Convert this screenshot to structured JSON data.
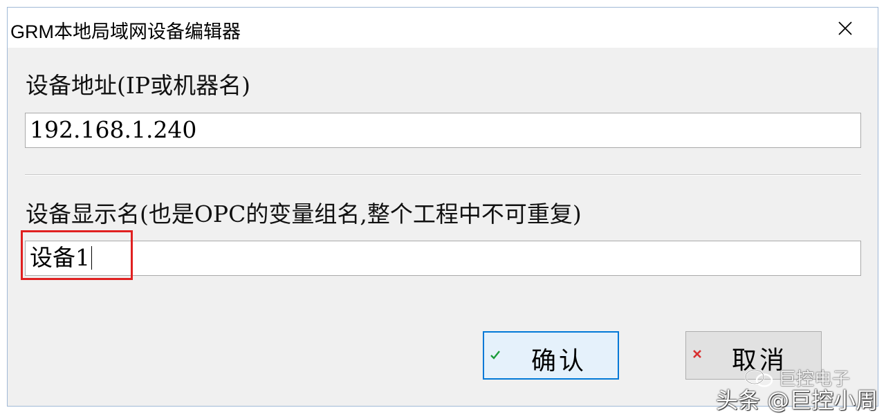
{
  "window": {
    "title": "GRM本地局域网设备编辑器",
    "close_icon": "close-icon"
  },
  "form": {
    "address_label": "设备地址(IP或机器名)",
    "address_value": "192.168.1.240",
    "display_name_label": "设备显示名(也是OPC的变量组名,整个工程中不可重复)",
    "display_name_value": "设备1"
  },
  "buttons": {
    "ok_label": "确认",
    "ok_icon": "checkmark-icon",
    "cancel_label": "取消",
    "cancel_icon": "x-mark-icon"
  },
  "watermark": {
    "logo_subtitle": "巨控电子",
    "main": "头条 @巨控小周"
  },
  "colors": {
    "highlight": "#e02020",
    "ok_check": "#1a9c3a",
    "cancel_x": "#d83030",
    "focus_border": "#0078d7"
  }
}
